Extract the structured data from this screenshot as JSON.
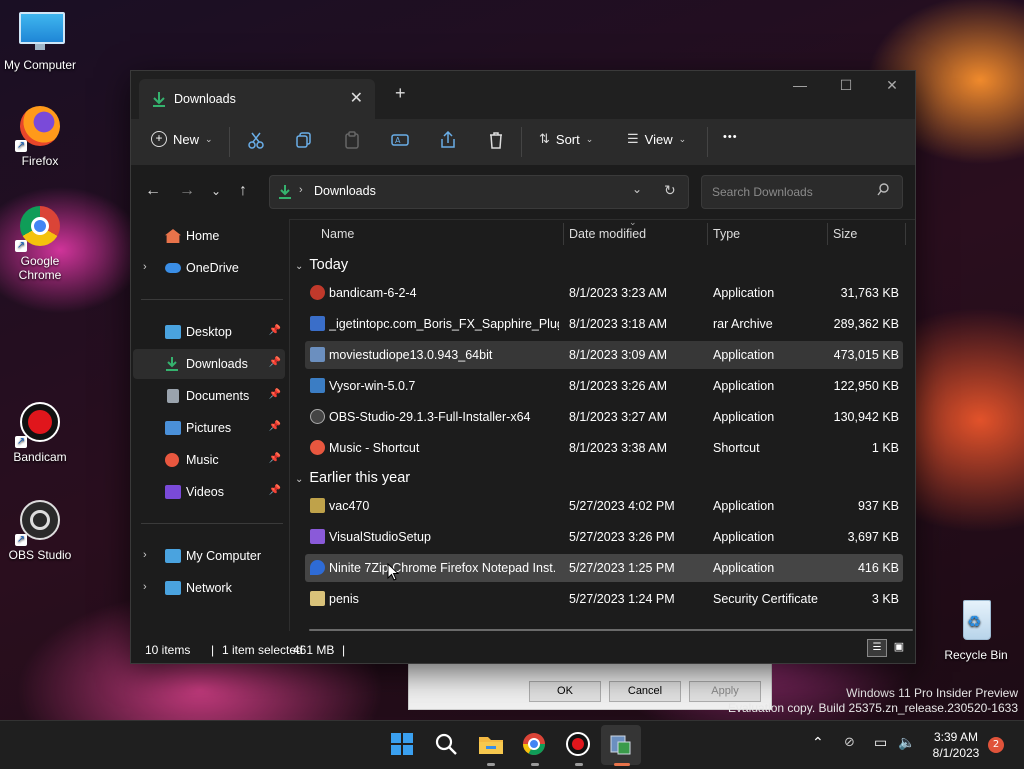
{
  "desktop": {
    "icons": [
      {
        "label": "My Computer",
        "icon": "monitor-icon"
      },
      {
        "label": "Firefox",
        "icon": "firefox-icon"
      },
      {
        "label": "Google Chrome",
        "icon": "chrome-icon"
      },
      {
        "label": "Bandicam",
        "icon": "bandicam-icon"
      },
      {
        "label": "OBS Studio",
        "icon": "obs-icon"
      },
      {
        "label": "Recycle Bin",
        "icon": "recycle-bin-icon"
      }
    ],
    "watermark": {
      "line1": "Windows 11 Pro Insider Preview",
      "line2": "Evaluation copy. Build 25375.zn_release.230520-1633"
    }
  },
  "background_dialog": {
    "ok": "OK",
    "cancel": "Cancel",
    "apply": "Apply"
  },
  "window": {
    "tab_title": "Downloads",
    "new_tab": "+",
    "commands": {
      "new": "New",
      "sort": "Sort",
      "view": "View",
      "more": "•••"
    },
    "address": {
      "path": "Downloads",
      "search_placeholder": "Search Downloads"
    },
    "sidebar": {
      "items": [
        {
          "label": "Home",
          "icon": "home-icon",
          "color": "#e8734a"
        },
        {
          "label": "OneDrive",
          "icon": "cloud-icon",
          "color": "#3a8ee6"
        },
        {
          "label": "Desktop",
          "icon": "desktop-icon",
          "color": "#4aa3df"
        },
        {
          "label": "Downloads",
          "icon": "download-icon",
          "color": "#35b26e"
        },
        {
          "label": "Documents",
          "icon": "document-icon",
          "color": "#9aa3ad"
        },
        {
          "label": "Pictures",
          "icon": "pictures-icon",
          "color": "#4a90d9"
        },
        {
          "label": "Music",
          "icon": "music-icon",
          "color": "#e8573f"
        },
        {
          "label": "Videos",
          "icon": "videos-icon",
          "color": "#7a4ad9"
        },
        {
          "label": "My Computer",
          "icon": "computer-icon",
          "color": "#4aa3df"
        },
        {
          "label": "Network",
          "icon": "network-icon",
          "color": "#4aa3df"
        }
      ]
    },
    "columns": {
      "name": "Name",
      "date": "Date modified",
      "type": "Type",
      "size": "Size"
    },
    "groups": {
      "today": "Today",
      "earlier": "Earlier this year"
    },
    "files_today": [
      {
        "name": "bandicam-6-2-4",
        "date": "8/1/2023 3:23 AM",
        "type": "Application",
        "size": "31,763 KB",
        "color": "#c0392b"
      },
      {
        "name": "_igetintopc.com_Boris_FX_Sapphire_Plug...",
        "date": "8/1/2023 3:18 AM",
        "type": "rar Archive",
        "size": "289,362 KB",
        "color": "#3a6ec9"
      },
      {
        "name": "moviestudiope13.0.943_64bit",
        "date": "8/1/2023 3:09 AM",
        "type": "Application",
        "size": "473,015 KB",
        "color": "#6b8fbf"
      },
      {
        "name": "Vysor-win-5.0.7",
        "date": "8/1/2023 3:26 AM",
        "type": "Application",
        "size": "122,950 KB",
        "color": "#3b7dc4"
      },
      {
        "name": "OBS-Studio-29.1.3-Full-Installer-x64",
        "date": "8/1/2023 3:27 AM",
        "type": "Application",
        "size": "130,942 KB",
        "color": "#444"
      },
      {
        "name": "Music - Shortcut",
        "date": "8/1/2023 3:38 AM",
        "type": "Shortcut",
        "size": "1 KB",
        "color": "#e8573f"
      }
    ],
    "files_earlier": [
      {
        "name": "vac470",
        "date": "5/27/2023 4:02 PM",
        "type": "Application",
        "size": "937 KB",
        "color": "#bfa24a"
      },
      {
        "name": "VisualStudioSetup",
        "date": "5/27/2023 3:26 PM",
        "type": "Application",
        "size": "3,697 KB",
        "color": "#8a5ad9"
      },
      {
        "name": "Ninite 7Zip Chrome Firefox Notepad Inst...",
        "date": "5/27/2023 1:25 PM",
        "type": "Application",
        "size": "416 KB",
        "color": "#2e6bd6"
      },
      {
        "name": "penis",
        "date": "5/27/2023 1:24 PM",
        "type": "Security Certificate",
        "size": "3 KB",
        "color": "#d9c27a"
      }
    ],
    "status": {
      "items": "10 items",
      "selected": "1 item selected",
      "sel_size": "461 MB"
    }
  },
  "taskbar": {
    "apps": [
      "start-icon",
      "search-icon",
      "file-explorer-icon",
      "chrome-icon",
      "bandicam-icon",
      "installer-icon"
    ],
    "time": "3:39 AM",
    "date": "8/1/2023",
    "notifications": "2"
  }
}
